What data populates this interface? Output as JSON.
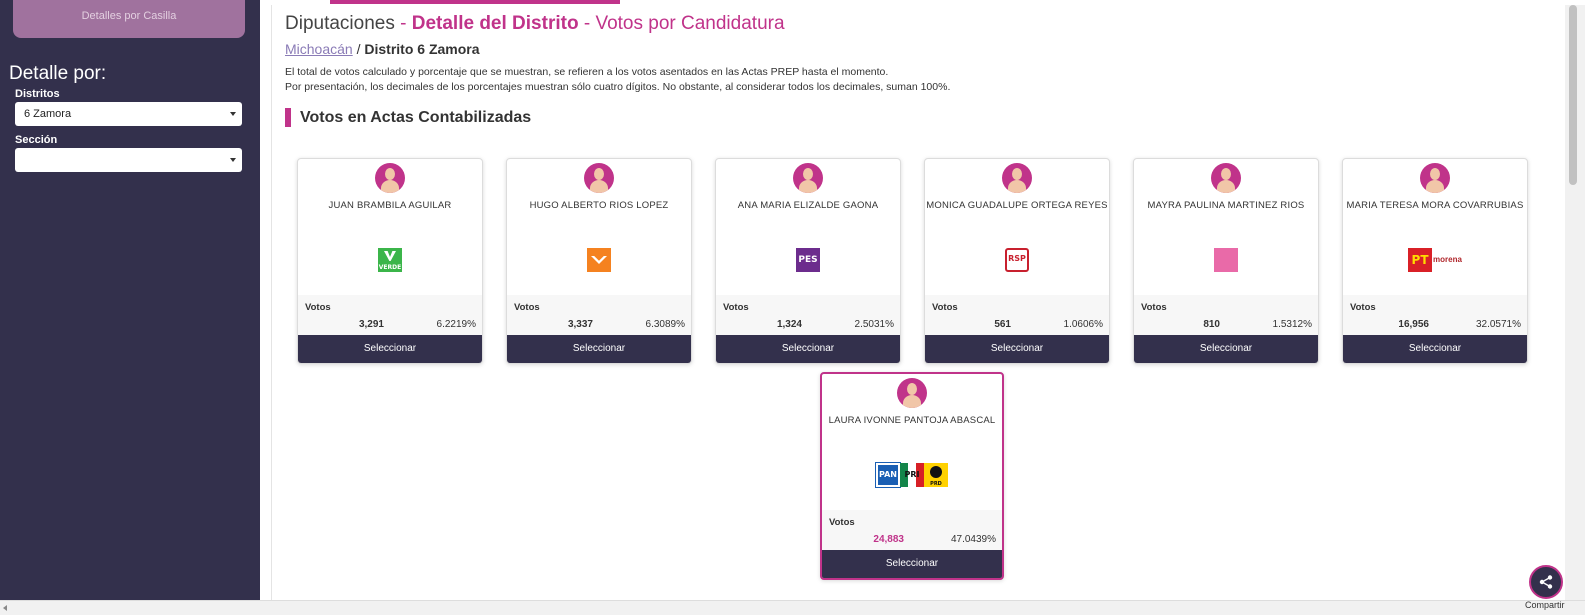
{
  "sidebar": {
    "casilla_button": "Detalles por Casilla",
    "detalle_title": "Detalle por:",
    "distritos_label": "Distritos",
    "distritos_value": "6 Zamora",
    "seccion_label": "Sección",
    "seccion_value": ""
  },
  "header": {
    "part1": "Diputaciones",
    "sep1": " - ",
    "part2": "Detalle del Distrito",
    "sep2": " - ",
    "part3": "Votos por Candidatura"
  },
  "breadcrumb": {
    "state": "Michoacán",
    "sep": " / ",
    "district": "Distrito 6 Zamora"
  },
  "notes": [
    "El total de votos calculado y porcentaje que se muestran, se refieren a los votos asentados en las Actas PREP hasta el momento.",
    "Por presentación, los decimales de los porcentajes muestran sólo cuatro dígitos. No obstante, al considerar todos los decimales, suman 100%."
  ],
  "section_title": "Votos en Actas Contabilizadas",
  "votos_label": "Votos",
  "select_label": "Seleccionar",
  "candidates": [
    {
      "name": "JUAN BRAMBILA AGUILAR",
      "party": "verde",
      "party_text": "VERDE",
      "votes": "3,291",
      "percent": "6.2219%"
    },
    {
      "name": "HUGO ALBERTO RIOS LOPEZ",
      "party": "mc",
      "party_text": "",
      "votes": "3,337",
      "percent": "6.3089%"
    },
    {
      "name": "ANA MARIA ELIZALDE GAONA",
      "party": "pes",
      "party_text": "PES",
      "votes": "1,324",
      "percent": "2.5031%"
    },
    {
      "name": "MONICA GUADALUPE ORTEGA REYES",
      "party": "rsp",
      "party_text": "RSP",
      "votes": "561",
      "percent": "1.0606%"
    },
    {
      "name": "MAYRA PAULINA MARTINEZ RIOS",
      "party": "fxm",
      "party_text": "",
      "votes": "810",
      "percent": "1.5312%"
    },
    {
      "name": "MARIA TERESA MORA COVARRUBIAS",
      "party": "pt-morena",
      "party_text": "PT",
      "party_text2": "morena",
      "votes": "16,956",
      "percent": "32.0571%"
    },
    {
      "name": "LAURA IVONNE PANTOJA ABASCAL",
      "party": "pan-pri-prd",
      "party_text": "PAN",
      "party_text2": "PRI",
      "party_text3": "PRD",
      "votes": "24,883",
      "percent": "47.0439%"
    }
  ],
  "share_label": "Compartir",
  "colors": {
    "accent": "#c0338a",
    "sidebar": "#33304c"
  }
}
